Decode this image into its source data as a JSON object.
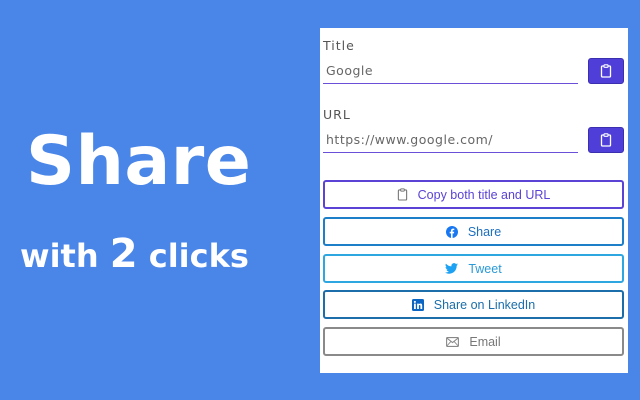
{
  "promo": {
    "title": "Share",
    "subtitle_prefix": "with",
    "subtitle_number": "2",
    "subtitle_suffix": "clicks"
  },
  "form": {
    "title_label": "Title",
    "title_value": "Google",
    "url_label": "URL",
    "url_value": "https://www.google.com/"
  },
  "buttons": {
    "copy_both": "Copy both title and URL",
    "share": "Share",
    "tweet": "Tweet",
    "linkedin": "Share on LinkedIn",
    "email": "Email"
  },
  "colors": {
    "background": "#4a86e8",
    "accent": "#4f3fd8",
    "facebook": "#1877f2",
    "twitter": "#1da1f2",
    "linkedin": "#0a66c2",
    "email": "#8a8a8a"
  },
  "icons": {
    "copy": "clipboard-icon",
    "share": "facebook-icon",
    "tweet": "twitter-icon",
    "linkedin": "linkedin-icon",
    "email": "envelope-icon"
  }
}
